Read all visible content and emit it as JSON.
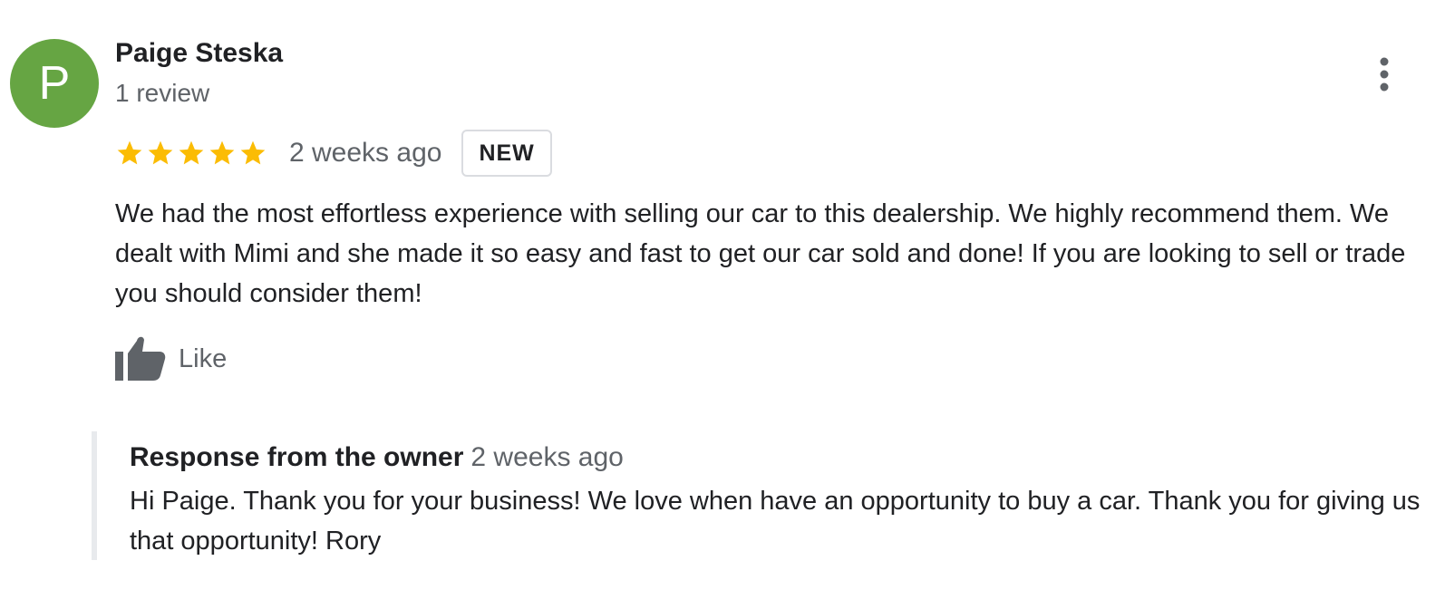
{
  "reviewer": {
    "initial": "P",
    "name": "Paige Steska",
    "review_count": "1 review",
    "avatar_color": "#66a543"
  },
  "review": {
    "rating": 5,
    "rating_max": 5,
    "time": "2 weeks ago",
    "badge": "NEW",
    "text": "We had the most effortless experience with selling our car to this dealership. We highly recommend them. We dealt with Mimi and she made it so easy and fast to get our car sold and done! If you are looking to sell or trade you should consider them!",
    "star_color": "#fbbc04"
  },
  "actions": {
    "like_label": "Like",
    "like_icon": "thumbs-up-icon",
    "more_icon": "more-vert-icon"
  },
  "owner_response": {
    "title": "Response from the owner",
    "time": "2 weeks ago",
    "text": "Hi Paige. Thank you for your business! We love when have an opportunity to buy a car. Thank you for giving us that opportunity! Rory"
  }
}
